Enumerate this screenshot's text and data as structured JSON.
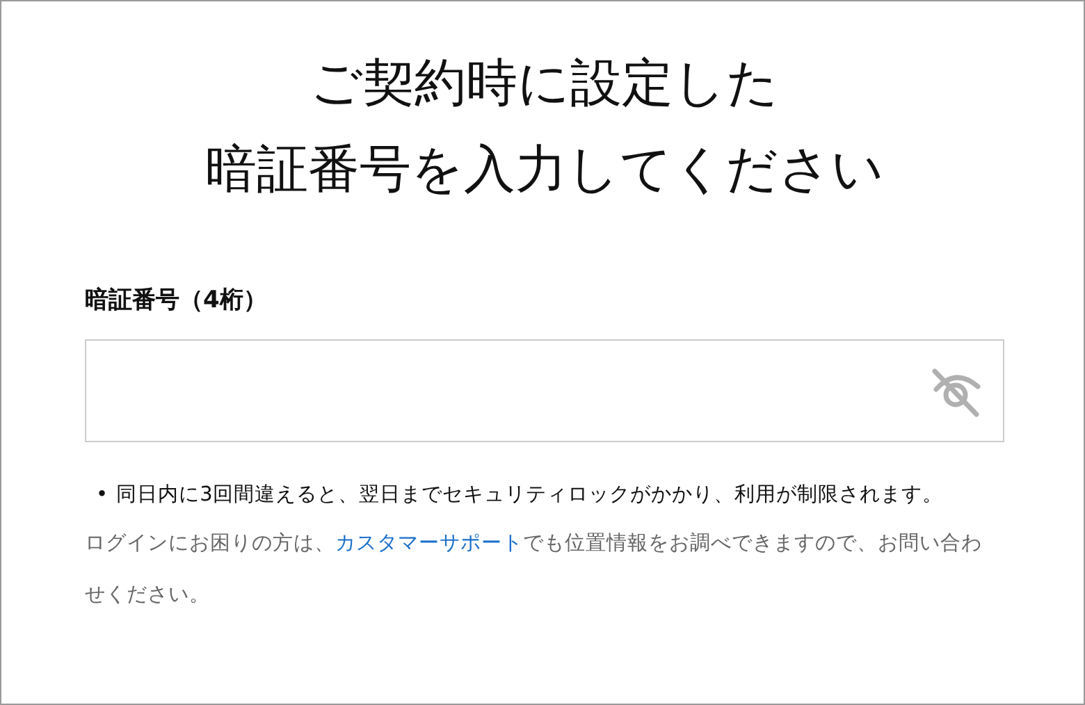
{
  "heading": [
    "ご契約時に設定した",
    "暗証番号を入力してください"
  ],
  "pin_field": {
    "label": "暗証番号（4桁）"
  },
  "notes": [
    {
      "bullet": "•",
      "text": "同日内に3回間違えると、翌日までセキュリティロックがかかり、利用が制限されます。"
    }
  ],
  "help": {
    "before": "ログインにお困りの方は、",
    "link": "カスタマーサポート",
    "after": "でも位置情報をお調べできますので、お問い合わせください。"
  }
}
